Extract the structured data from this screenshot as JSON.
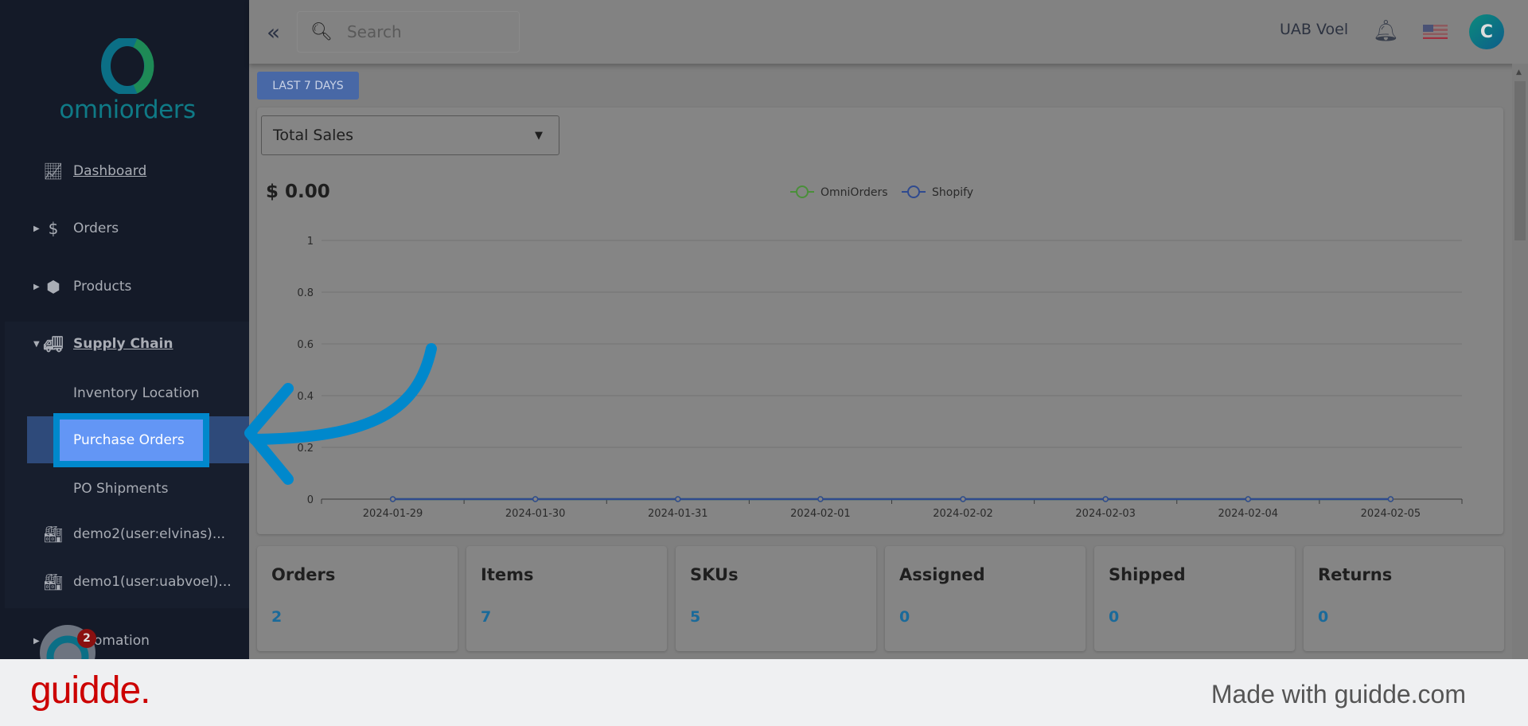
{
  "brand": {
    "name": "omniorders"
  },
  "sidebar": {
    "items": [
      {
        "label": "Dashboard",
        "icon": "chart-line-icon"
      },
      {
        "label": "Orders",
        "icon": "dollar-icon"
      },
      {
        "label": "Products",
        "icon": "box-icon"
      },
      {
        "label": "Supply Chain",
        "icon": "truck-icon"
      },
      {
        "label": "Inventory Location"
      },
      {
        "label": "Purchase Orders",
        "active": true
      },
      {
        "label": "PO Shipments"
      },
      {
        "label": "demo2(user:elvinas)...",
        "icon": "warehouse-icon"
      },
      {
        "label": "demo1(user:uabvoel)...",
        "icon": "warehouse-icon"
      },
      {
        "label": "omation",
        "icon": "gear-icon"
      }
    ],
    "notification_count": "2"
  },
  "header": {
    "search_placeholder": "Search",
    "org": "UAB Voel",
    "avatar_letter": "C",
    "language": "en-US"
  },
  "main": {
    "range_button": "LAST 7 DAYS",
    "metric_select": "Total Sales",
    "total": "$ 0.00",
    "stats": [
      {
        "label": "Orders",
        "value": "2"
      },
      {
        "label": "Items",
        "value": "7"
      },
      {
        "label": "SKUs",
        "value": "5"
      },
      {
        "label": "Assigned",
        "value": "0"
      },
      {
        "label": "Shipped",
        "value": "0"
      },
      {
        "label": "Returns",
        "value": "0"
      }
    ]
  },
  "chart_data": {
    "type": "line",
    "categories": [
      "2024-01-29",
      "2024-01-30",
      "2024-01-31",
      "2024-02-01",
      "2024-02-02",
      "2024-02-03",
      "2024-02-04",
      "2024-02-05"
    ],
    "series": [
      {
        "name": "OmniOrders",
        "color": "#4a8f3a",
        "values": [
          0,
          0,
          0,
          0,
          0,
          0,
          0,
          0
        ]
      },
      {
        "name": "Shopify",
        "color": "#2f4a8f",
        "values": [
          0,
          0,
          0,
          0,
          0,
          0,
          0,
          0
        ]
      }
    ],
    "ylim": [
      0,
      1
    ],
    "yticks": [
      "0",
      "0.2",
      "0.4",
      "0.6",
      "0.8",
      "1"
    ],
    "grid": true,
    "legend": "top-center"
  },
  "footer": {
    "logo": "guidde.",
    "made_with": "Made with guidde.com"
  },
  "colors": {
    "sidebar": "#141a28",
    "highlight": "#6396f5",
    "arrow": "#0088cc",
    "accent": "#1a6a9a"
  }
}
